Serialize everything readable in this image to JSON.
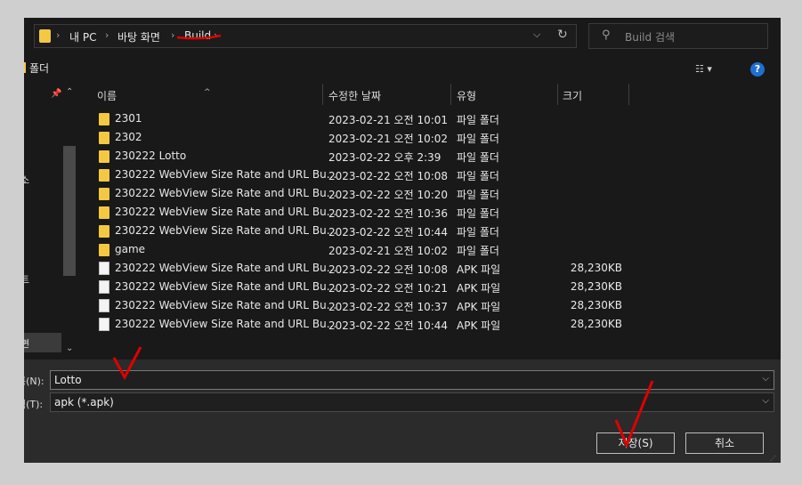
{
  "address_bar": {
    "crumbs": [
      "내 PC",
      "바탕 화면",
      "Build"
    ],
    "separator": "›"
  },
  "search": {
    "placeholder": "Build 검색"
  },
  "toolbar": {
    "new_folder_label": "폴더"
  },
  "nav": {
    "items": [
      "소",
      "트",
      "면"
    ]
  },
  "columns": {
    "name": "이름",
    "modified": "수정한 날짜",
    "type": "유형",
    "size": "크기"
  },
  "files": [
    {
      "name": "2301",
      "modified": "2023-02-21 오전 10:01",
      "type": "파일 폴더",
      "size": "",
      "kind": "folder"
    },
    {
      "name": "2302",
      "modified": "2023-02-21 오전 10:02",
      "type": "파일 폴더",
      "size": "",
      "kind": "folder"
    },
    {
      "name": "230222 Lotto",
      "modified": "2023-02-22 오후 2:39",
      "type": "파일 폴더",
      "size": "",
      "kind": "folder"
    },
    {
      "name": "230222 WebView Size Rate and URL Bu...",
      "modified": "2023-02-22 오전 10:08",
      "type": "파일 폴더",
      "size": "",
      "kind": "folder"
    },
    {
      "name": "230222 WebView Size Rate and URL Bu...",
      "modified": "2023-02-22 오전 10:20",
      "type": "파일 폴더",
      "size": "",
      "kind": "folder"
    },
    {
      "name": "230222 WebView Size Rate and URL Bu...",
      "modified": "2023-02-22 오전 10:36",
      "type": "파일 폴더",
      "size": "",
      "kind": "folder"
    },
    {
      "name": "230222 WebView Size Rate and URL Bu...",
      "modified": "2023-02-22 오전 10:44",
      "type": "파일 폴더",
      "size": "",
      "kind": "folder"
    },
    {
      "name": "game",
      "modified": "2023-02-21 오전 10:02",
      "type": "파일 폴더",
      "size": "",
      "kind": "folder"
    },
    {
      "name": "230222 WebView Size Rate and URL Bu...",
      "modified": "2023-02-22 오전 10:08",
      "type": "APK 파일",
      "size": "28,230KB",
      "kind": "file"
    },
    {
      "name": "230222 WebView Size Rate and URL Bu...",
      "modified": "2023-02-22 오전 10:21",
      "type": "APK 파일",
      "size": "28,230KB",
      "kind": "file"
    },
    {
      "name": "230222 WebView Size Rate and URL Bu...",
      "modified": "2023-02-22 오전 10:37",
      "type": "APK 파일",
      "size": "28,230KB",
      "kind": "file"
    },
    {
      "name": "230222 WebView Size Rate and URL Bu...",
      "modified": "2023-02-22 오전 10:44",
      "type": "APK 파일",
      "size": "28,230KB",
      "kind": "file"
    }
  ],
  "save_form": {
    "filename_label": "름(N):",
    "filename_value": "Lotto",
    "filetype_label": "식(T):",
    "filetype_value": "apk (*.apk)",
    "save_button": "저장(S)",
    "cancel_button": "취소"
  },
  "colors": {
    "folder": "#f5c842",
    "annotation": "#e00000",
    "help": "#1e6fd0"
  },
  "icons": {
    "folder": "folder-icon",
    "file": "file-icon",
    "refresh": "refresh-icon",
    "search": "search-icon",
    "help": "help-icon"
  }
}
